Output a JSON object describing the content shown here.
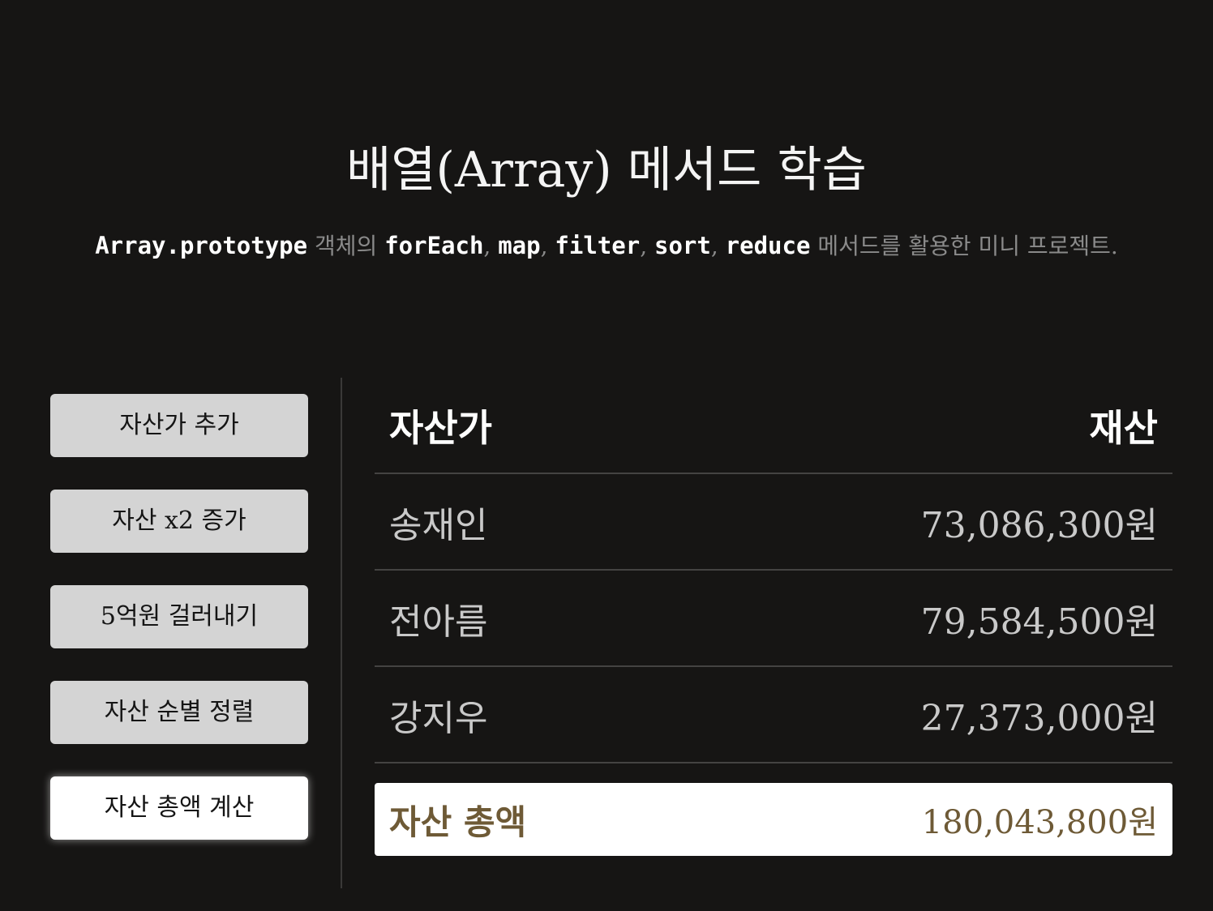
{
  "header": {
    "title": "배열(Array) 메서드 학습",
    "subtitle": {
      "api": "Array.prototype",
      "text1": " 객체의 ",
      "m1": "forEach",
      "sep1": ", ",
      "m2": "map",
      "sep2": ", ",
      "m3": "filter",
      "sep3": ", ",
      "m4": "sort",
      "sep4": ", ",
      "m5": "reduce",
      "text2": " 메서드를 활용한 미니 프로젝트."
    }
  },
  "sidebar": {
    "buttons": [
      {
        "label": "자산가 추가"
      },
      {
        "label": "자산 x2 증가"
      },
      {
        "label": "5억원 걸러내기"
      },
      {
        "label": "자산 순별 정렬"
      },
      {
        "label": "자산 총액 계산",
        "active": true
      }
    ]
  },
  "table": {
    "columns": [
      "자산가",
      "재산"
    ],
    "rows": [
      {
        "name": "송재인",
        "wealth": "73,086,300원"
      },
      {
        "name": "전아름",
        "wealth": "79,584,500원"
      },
      {
        "name": "강지우",
        "wealth": "27,373,000원"
      }
    ],
    "total": {
      "label": "자산 총액",
      "value": "180,043,800원"
    }
  },
  "colors": {
    "background": "#161514",
    "button": "#d4d4d4",
    "button_active": "#ffffff",
    "total_text": "#6e5a36"
  }
}
